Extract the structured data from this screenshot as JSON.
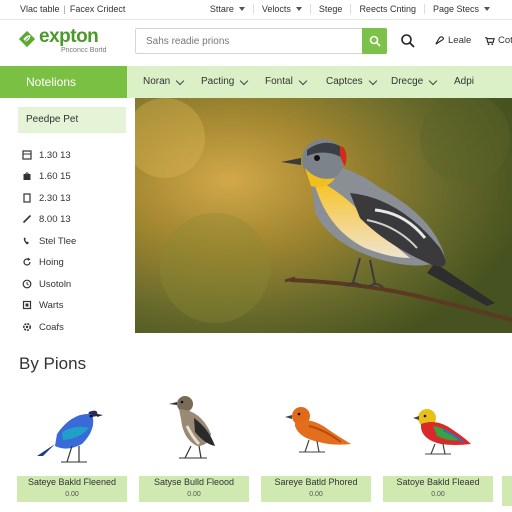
{
  "topbar": {
    "left_a": "Vlac table",
    "left_b": "Facex Cridect",
    "links": [
      "Sttare",
      "Velocts",
      "Stege",
      "Reects Cnting",
      "Page Stecs"
    ]
  },
  "header": {
    "logo_name": "expton",
    "logo_tagline": "Pnconcc Bortd",
    "search_placeholder": "Sahs readie prions",
    "user_label": "Leale",
    "cart_label": "Cotn"
  },
  "nav": {
    "active": "Notelions",
    "items": [
      "Noran",
      "Pacting",
      "Fontal",
      "Captces",
      "Drecge",
      "Adpi"
    ]
  },
  "sidebar": {
    "heading": "Peedpe Pet",
    "items": [
      {
        "label": "1.30 13",
        "icon": "grid-icon"
      },
      {
        "label": "1.60 15",
        "icon": "bag-icon"
      },
      {
        "label": "2.30 13",
        "icon": "doc-icon"
      },
      {
        "label": "8.00 13",
        "icon": "pencil-icon"
      },
      {
        "label": "Stel Tlee",
        "icon": "phone-icon"
      },
      {
        "label": "Hoing",
        "icon": "refresh-icon"
      },
      {
        "label": "Usotoln",
        "icon": "clock-icon"
      },
      {
        "label": "Warts",
        "icon": "box-icon"
      },
      {
        "label": "Coafs",
        "icon": "gear-icon"
      }
    ]
  },
  "section": {
    "title": "By Pions",
    "cards": [
      {
        "label": "Sateye Bakld Fleened",
        "sub": "0.00",
        "bird": "blue-bird"
      },
      {
        "label": "Satyse Bulld Fleood",
        "sub": "0.00",
        "bird": "gray-bird"
      },
      {
        "label": "Sareye Batld Phored",
        "sub": "0.00",
        "bird": "orange-bird"
      },
      {
        "label": "Satoye Bakld Fleaed",
        "sub": "0.00",
        "bird": "rainbow-bird"
      }
    ]
  },
  "colors": {
    "brand_green": "#4a9a2a",
    "nav_active": "#79c043",
    "nav_bg": "#dcf0c8",
    "card_label_bg": "#cfe9b0"
  }
}
